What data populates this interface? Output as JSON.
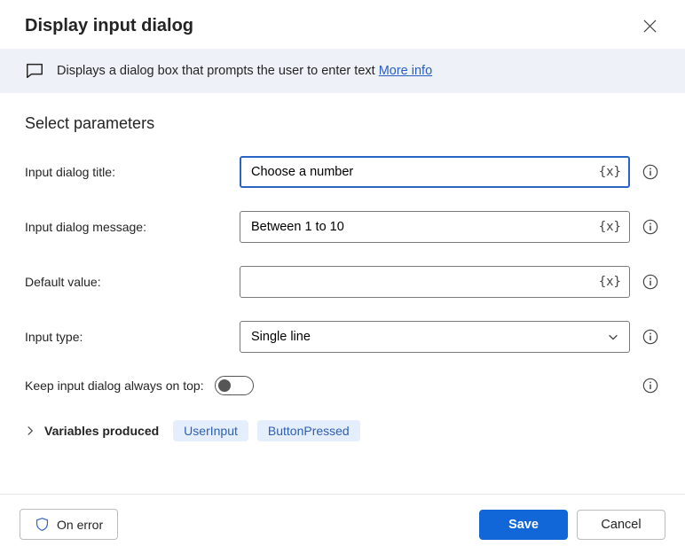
{
  "header": {
    "title": "Display input dialog"
  },
  "banner": {
    "text": "Displays a dialog box that prompts the user to enter text ",
    "link_text": "More info"
  },
  "section_title": "Select parameters",
  "fields": {
    "title_label": "Input dialog title:",
    "title_value": "Choose a number",
    "message_label": "Input dialog message:",
    "message_value": "Between 1 to 10",
    "default_label": "Default value:",
    "default_value": "",
    "type_label": "Input type:",
    "type_value": "Single line",
    "ontop_label": "Keep input dialog always on top:",
    "ontop_value": false
  },
  "var_token": "{x}",
  "variables": {
    "label": "Variables produced",
    "items": [
      "UserInput",
      "ButtonPressed"
    ]
  },
  "footer": {
    "on_error": "On error",
    "save": "Save",
    "cancel": "Cancel"
  }
}
